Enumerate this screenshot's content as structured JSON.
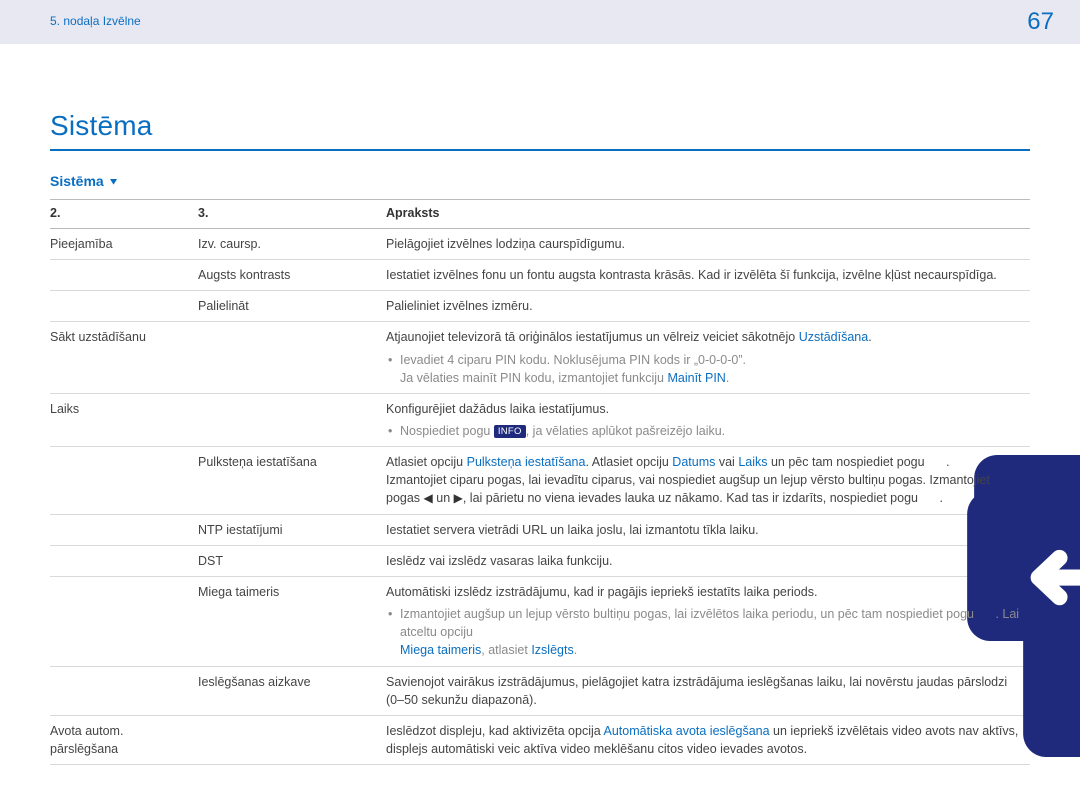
{
  "header": {
    "breadcrumb": "5. nodaļa Izvēlne",
    "page_number": "67"
  },
  "title": "Sistēma",
  "subsection": "Sistēma",
  "table": {
    "headers": {
      "c2": "2.",
      "c3": "3.",
      "desc": "Apraksts"
    },
    "rows": {
      "pieejamiba": {
        "c1": "Pieejamība",
        "c2": "Izv. caursp.",
        "desc": "Pielāgojiet izvēlnes lodziņa caurspīdīgumu."
      },
      "augsts": {
        "c2": "Augsts kontrasts",
        "desc": "Iestatiet izvēlnes fonu un fontu augsta kontrasta krāsās. Kad ir izvēlēta šī funkcija, izvēlne kļūst necaurspīdīga."
      },
      "palielinat": {
        "c2": "Palielināt",
        "desc": "Palieliniet izvēlnes izmēru."
      },
      "sakt": {
        "c1": "Sākt uzstādīšanu",
        "desc_pre": "Atjaunojiet televizorā tā oriģinālos iestatījumus un vēlreiz veiciet sākotnējo ",
        "desc_link": "Uzstādīšana",
        "desc_post": ".",
        "bullet1": "Ievadiet 4 ciparu PIN kodu. Noklusējuma PIN kods ir „0-0-0-0”.",
        "bullet2_pre": "Ja vēlaties mainīt PIN kodu, izmantojiet funkciju ",
        "bullet2_link": "Mainīt PIN",
        "bullet2_post": "."
      },
      "laiks": {
        "c1": "Laiks",
        "desc": "Konfigurējiet dažādus laika iestatījumus.",
        "bullet_pre": "Nospiediet pogu ",
        "bullet_pill": "INFO",
        "bullet_post": ", ja vēlaties aplūkot pašreizējo laiku."
      },
      "pulkstena": {
        "c2": "Pulksteņa iestatīšana",
        "p1_a": "Atlasiet opciju ",
        "p1_link1": "Pulksteņa iestatīšana",
        "p1_b": ". Atlasiet opciju ",
        "p1_link2": "Datums",
        "p1_c": " vai ",
        "p1_link3": "Laiks",
        "p1_d": " un pēc tam nospiediet pogu ",
        "p1_e": ".",
        "p2_a": "Izmantojiet ciparu pogas, lai ievadītu ciparus, vai nospiediet augšup un lejup vērsto bultiņu pogas. Izmantojiet pogas ",
        "p2_arrow_l": "◀",
        "p2_mid": " un ",
        "p2_arrow_r": "▶",
        "p2_b": ", lai pārietu no viena ievades lauka uz nākamo. Kad tas ir izdarīts, nospiediet pogu ",
        "p2_c": "."
      },
      "ntp": {
        "c2": "NTP iestatījumi",
        "desc": "Iestatiet servera vietrādi URL un laika joslu, lai izmantotu tīkla laiku."
      },
      "dst": {
        "c2": "DST",
        "desc": "Ieslēdz vai izslēdz vasaras laika funkciju."
      },
      "miega": {
        "c2": "Miega taimeris",
        "desc": "Automātiski izslēdz izstrādājumu, kad ir pagājis iepriekš iestatīts laika periods.",
        "bul_a": "Izmantojiet augšup un lejup vērsto bultiņu pogas, lai izvēlētos laika periodu, un pēc tam nospiediet pogu ",
        "bul_b": ". Lai atceltu opciju ",
        "bul_link1": "Miega taimeris",
        "bul_c": ", atlasiet ",
        "bul_link2": "Izslēgts",
        "bul_d": "."
      },
      "aizkave": {
        "c2": "Ieslēgšanas aizkave",
        "desc": "Savienojot vairākus izstrādājumus, pielāgojiet katra izstrādājuma ieslēgšanas laiku, lai novērstu jaudas pārslodzi (0–50 sekunžu diapazonā)."
      },
      "avota": {
        "c1": "Avota autom. pārslēgšana",
        "desc_a": "Ieslēdzot displeju, kad aktivizēta opcija ",
        "desc_link": "Automātiska avota ieslēgšana",
        "desc_b": " un iepriekš izvēlētais video avots nav aktīvs, displejs automātiski veic aktīva video meklēšanu citos video ievades avotos."
      }
    }
  }
}
